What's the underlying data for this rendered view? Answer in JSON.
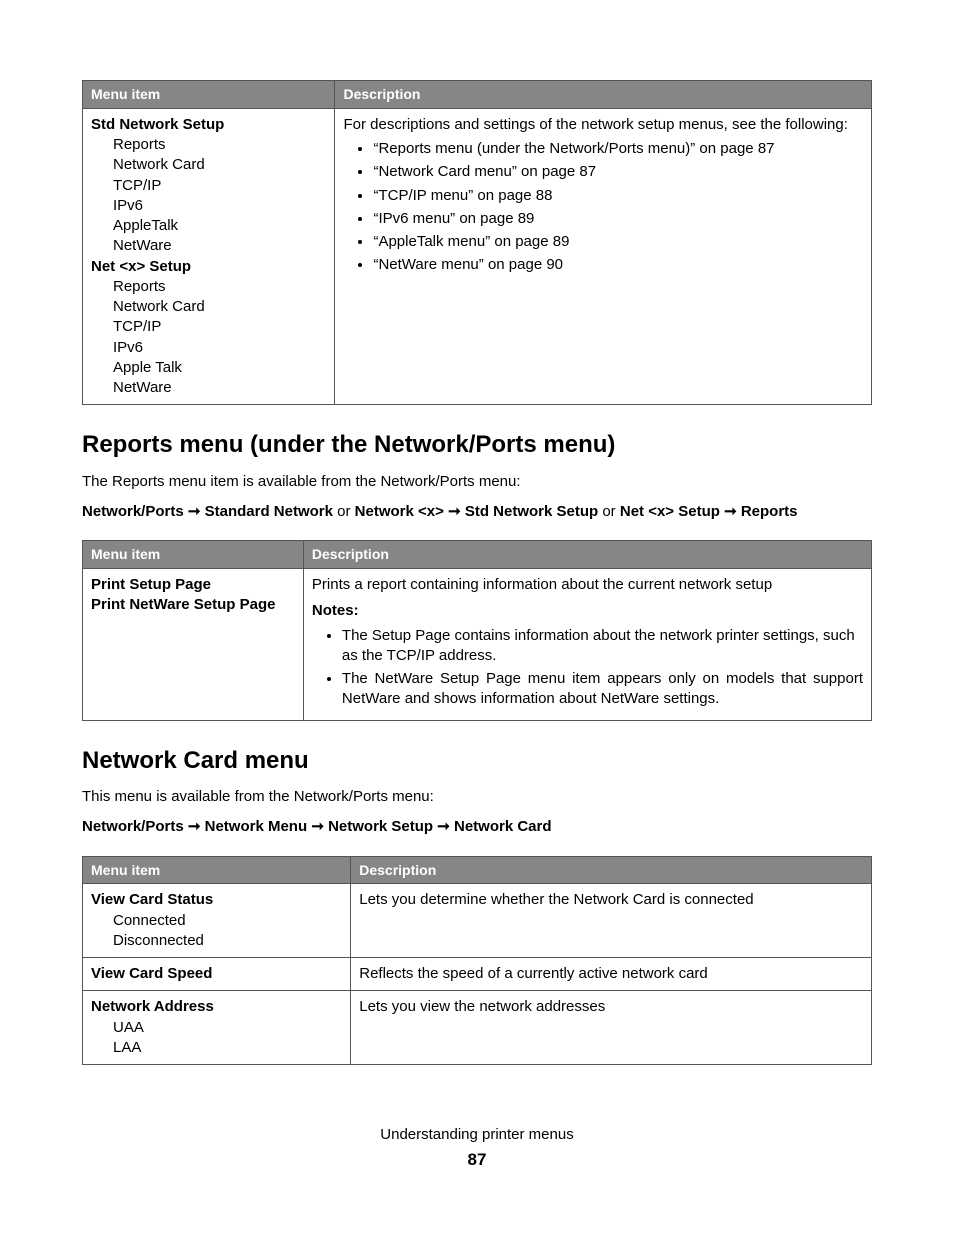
{
  "table1": {
    "headers": [
      "Menu item",
      "Description"
    ],
    "menu1_title": "Std Network Setup",
    "menu1_items": [
      "Reports",
      "Network Card",
      "TCP/IP",
      "IPv6",
      "AppleTalk",
      "NetWare"
    ],
    "menu2_title": "Net <x> Setup",
    "menu2_items": [
      "Reports",
      "Network Card",
      "TCP/IP",
      "IPv6",
      "Apple Talk",
      "NetWare"
    ],
    "desc_intro": "For descriptions and settings of the network setup menus, see the following:",
    "desc_items": [
      "“Reports menu (under the Network/Ports menu)” on page 87",
      "“Network Card menu” on page 87",
      "“TCP/IP menu” on page 88",
      "“IPv6 menu” on page 89",
      "“AppleTalk menu” on page 89",
      "“NetWare menu” on page 90"
    ]
  },
  "section1": {
    "heading": "Reports menu (under the Network/Ports menu)",
    "intro": "The Reports menu item is available from the Network/Ports menu:",
    "path_parts": [
      "Network/Ports",
      "Standard Network",
      "Network <x>",
      "Std Network Setup",
      "Net <x> Setup",
      "Reports"
    ],
    "path_or": "or"
  },
  "table2": {
    "headers": [
      "Menu item",
      "Description"
    ],
    "menu_items": [
      "Print Setup Page",
      "Print NetWare Setup Page"
    ],
    "desc_intro": "Prints a report containing information about the current network setup",
    "notes_label": "Notes:",
    "notes": [
      "The Setup Page contains information about the network printer settings, such as the TCP/IP address.",
      "The NetWare Setup Page menu item appears only on models that support NetWare and shows information about NetWare settings."
    ]
  },
  "section2": {
    "heading": "Network Card menu",
    "intro": "This menu is available from the Network/Ports menu:",
    "path_parts": [
      "Network/Ports",
      "Network Menu",
      "Network Setup",
      "Network Card"
    ]
  },
  "table3": {
    "headers": [
      "Menu item",
      "Description"
    ],
    "rows": [
      {
        "title": "View Card Status",
        "subs": [
          "Connected",
          "Disconnected"
        ],
        "desc": "Lets you determine whether the Network Card is connected"
      },
      {
        "title": "View Card Speed",
        "subs": [],
        "desc": "Reflects the speed of a currently active network card"
      },
      {
        "title": "Network Address",
        "subs": [
          "UAA",
          "LAA"
        ],
        "desc": "Lets you view the network addresses"
      }
    ]
  },
  "footer": {
    "chapter": "Understanding printer menus",
    "page": "87"
  },
  "arrow": "➞"
}
